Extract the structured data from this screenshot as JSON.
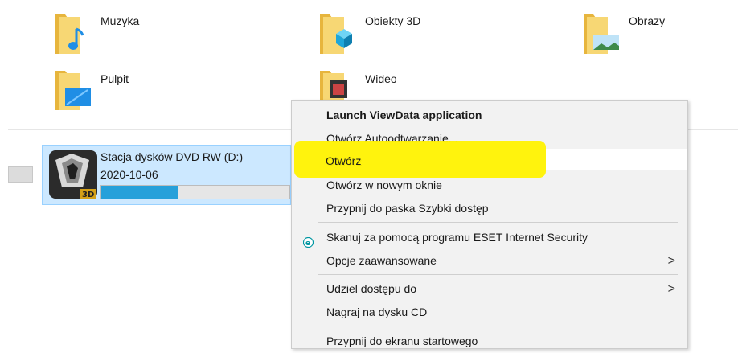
{
  "folders": [
    {
      "label": "Muzyka"
    },
    {
      "label": "Obiekty 3D"
    },
    {
      "label": "Obrazy"
    },
    {
      "label": "Pulpit"
    },
    {
      "label": "Wideo"
    }
  ],
  "drive": {
    "name": "Stacja dysków DVD RW (D:)",
    "date": "2020-10-06",
    "usage_fraction": 0.41
  },
  "context_menu": {
    "items": [
      {
        "label": "Launch ViewData application"
      },
      {
        "label": "Otwórz Autoodtwarzanie..."
      },
      {
        "label": "Otwórz"
      },
      {
        "label": "Otwórz w nowym oknie"
      },
      {
        "label": "Przypnij do paska Szybki dostęp"
      },
      {
        "label": "Skanuj za pomocą programu ESET Internet Security",
        "icon": "eset-icon"
      },
      {
        "label": "Opcje zaawansowane",
        "submenu_glyph": ">"
      },
      {
        "label": "Udziel dostępu do",
        "submenu_glyph": ">"
      },
      {
        "label": "Nagraj na dysku CD"
      },
      {
        "label": "Przypnij do ekranu startowego"
      }
    ]
  },
  "colors": {
    "selection_bg": "#cce8ff",
    "highlight": "#fff200",
    "progress": "#26a0da",
    "menu_bg": "#f2f2f2"
  }
}
